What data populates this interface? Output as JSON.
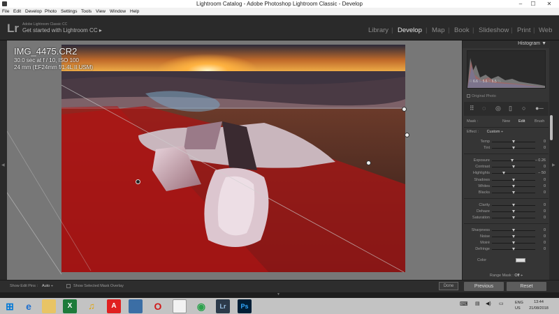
{
  "window": {
    "title": "Lightroom Catalog - Adobe Photoshop Lightroom Classic - Develop",
    "controls": [
      "–",
      "☐",
      "✕"
    ]
  },
  "menu": [
    "File",
    "Edit",
    "Develop",
    "Photo",
    "Settings",
    "Tools",
    "View",
    "Window",
    "Help"
  ],
  "identity": {
    "logo": "Lr",
    "small": "Adobe Lightroom Classic CC",
    "big": "Get started with Lightroom CC",
    "arrow": "▸"
  },
  "modules": {
    "items": [
      "Library",
      "Develop",
      "Map",
      "Book",
      "Slideshow",
      "Print",
      "Web"
    ],
    "active": "Develop",
    "separator": "|"
  },
  "photo_info": {
    "filename": "IMG_4475.CR2",
    "exposure": "30.0 sec at f / 10, ISO 100",
    "lens": "24 mm (EF24mm f/1.4L II USM)"
  },
  "histogram": {
    "label": "Histogram",
    "arrow": "▼",
    "readout": [
      "R",
      "6.6",
      "G",
      "5.6",
      "B",
      "6.5",
      "%"
    ],
    "original_photo": "Original Photo"
  },
  "mask": {
    "label": "Mask :",
    "new": "New",
    "edit": "Edit",
    "brush": "Brush"
  },
  "effect": {
    "label": "Effect :",
    "value": "Custom ÷"
  },
  "sliders": [
    {
      "label": "Temp",
      "value": "0",
      "pos": 0.5
    },
    {
      "label": "Tint",
      "value": "0",
      "pos": 0.5
    },
    {
      "label": "Exposure",
      "value": "– 0.26",
      "pos": 0.47
    },
    {
      "label": "Contrast",
      "value": "0",
      "pos": 0.5
    },
    {
      "label": "Highlights",
      "value": "– 50",
      "pos": 0.28
    },
    {
      "label": "Shadows",
      "value": "0",
      "pos": 0.5
    },
    {
      "label": "Whites",
      "value": "0",
      "pos": 0.5
    },
    {
      "label": "Blacks",
      "value": "0",
      "pos": 0.5
    },
    {
      "label": "Clarity",
      "value": "0",
      "pos": 0.5
    },
    {
      "label": "Dehaze",
      "value": "0",
      "pos": 0.5
    },
    {
      "label": "Saturation",
      "value": "0",
      "pos": 0.5
    },
    {
      "label": "Sharpness",
      "value": "0",
      "pos": 0.5
    },
    {
      "label": "Noise",
      "value": "0",
      "pos": 0.5
    },
    {
      "label": "Moiré",
      "value": "0",
      "pos": 0.5
    },
    {
      "label": "Defringe",
      "value": "0",
      "pos": 0.5
    }
  ],
  "color_label": "Color",
  "range_mask": {
    "label": "Range Mask :",
    "value": "Off ÷"
  },
  "toolbar": {
    "show_edit_pins_label": "Show Edit Pins :",
    "show_edit_pins_value": "Auto ÷",
    "show_mask_overlay": "Show Selected Mask Overlay",
    "done": "Done",
    "previous": "Previous",
    "reset": "Reset"
  },
  "taskbar": {
    "tray_lang_1": "ENG",
    "tray_lang_2": "US",
    "time": "13:44",
    "date": "21/08/2018"
  },
  "colors": {
    "accent_mask": "#b41414",
    "panel_bg": "#353535"
  }
}
